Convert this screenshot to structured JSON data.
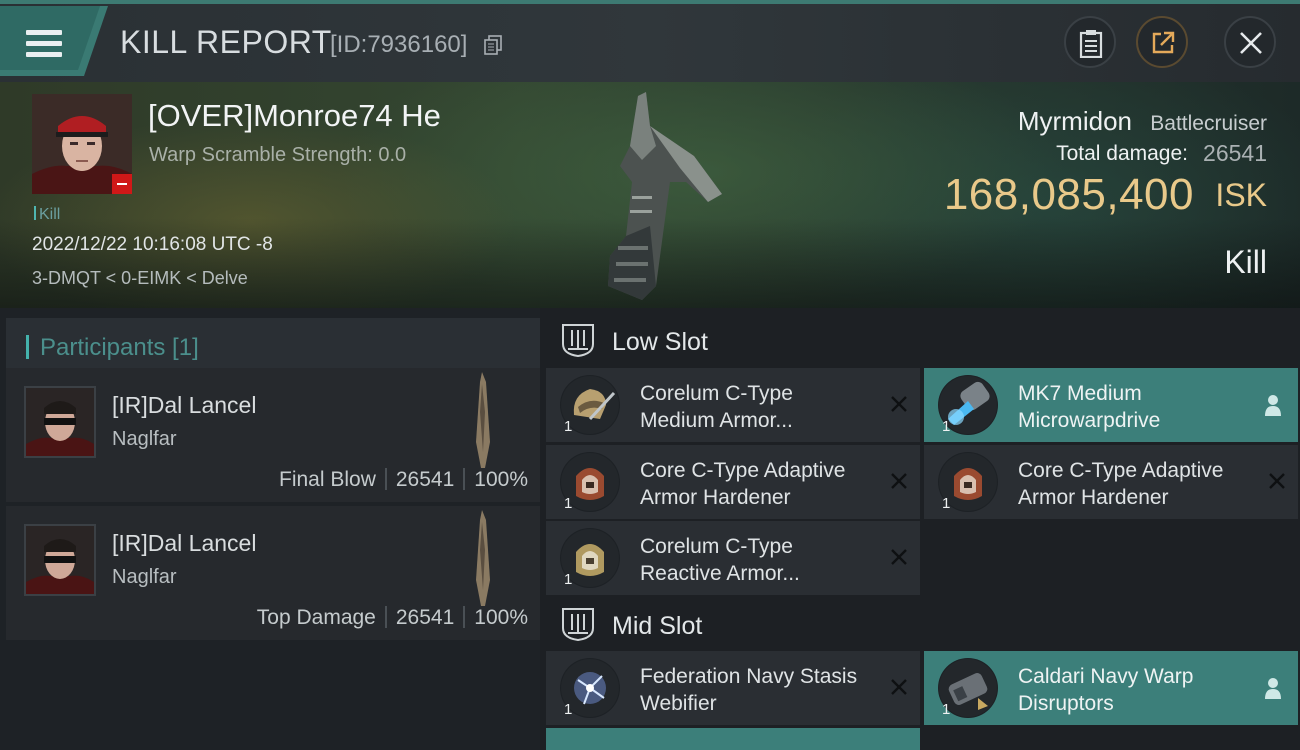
{
  "header": {
    "title": "KILL REPORT",
    "report_id": "[ID:7936160]"
  },
  "victim": {
    "name": "[OVER]Monroe74 He",
    "warp_scramble": "Warp Scramble Strength: 0.0",
    "kill_tag": "Kill",
    "datetime": "2022/12/22 10:16:08 UTC -8",
    "location": "3-DMQT < 0-EIMK < Delve",
    "ship_name": "Myrmidon",
    "ship_class": "Battlecruiser",
    "total_damage_label": "Total damage:",
    "total_damage": "26541",
    "isk_value": "168,085,400",
    "isk_unit": "ISK",
    "result": "Kill"
  },
  "participants": {
    "title": "Participants [1]",
    "items": [
      {
        "name": "[IR]Dal Lancel",
        "ship": "Naglfar",
        "role": "Final Blow",
        "damage": "26541",
        "percent": "100%"
      },
      {
        "name": "[IR]Dal Lancel",
        "ship": "Naglfar",
        "role": "Top Damage",
        "damage": "26541",
        "percent": "100%"
      }
    ]
  },
  "low_slot": {
    "title": "Low Slot",
    "modules": [
      {
        "name": "Corelum C-Type Medium Armor...",
        "qty": "1",
        "status": "destroyed"
      },
      {
        "name": "MK7 Medium Microwarpdrive",
        "qty": "1",
        "status": "dropped"
      },
      {
        "name": "Core C-Type Adaptive Armor Hardener",
        "qty": "1",
        "status": "destroyed"
      },
      {
        "name": "Core C-Type Adaptive Armor Hardener",
        "qty": "1",
        "status": "destroyed"
      },
      {
        "name": "Corelum C-Type Reactive Armor...",
        "qty": "1",
        "status": "destroyed"
      }
    ]
  },
  "mid_slot": {
    "title": "Mid Slot",
    "modules": [
      {
        "name": "Federation Navy Stasis Webifier",
        "qty": "1",
        "status": "destroyed"
      },
      {
        "name": "Caldari Navy Warp Disruptors",
        "qty": "1",
        "status": "dropped"
      }
    ]
  },
  "icons": {
    "menu": "hamburger-menu-icon",
    "copy": "copy-icon",
    "clipboard": "clipboard-icon",
    "share": "share-icon",
    "close": "close-icon",
    "destroyed": "x-icon",
    "dropped": "pilot-icon",
    "slot": "slot-emblem-icon"
  },
  "colors": {
    "accent_teal": "#3c7f7a",
    "isk_gold": "#e9c98a",
    "victim_badge_red": "#d01818"
  }
}
